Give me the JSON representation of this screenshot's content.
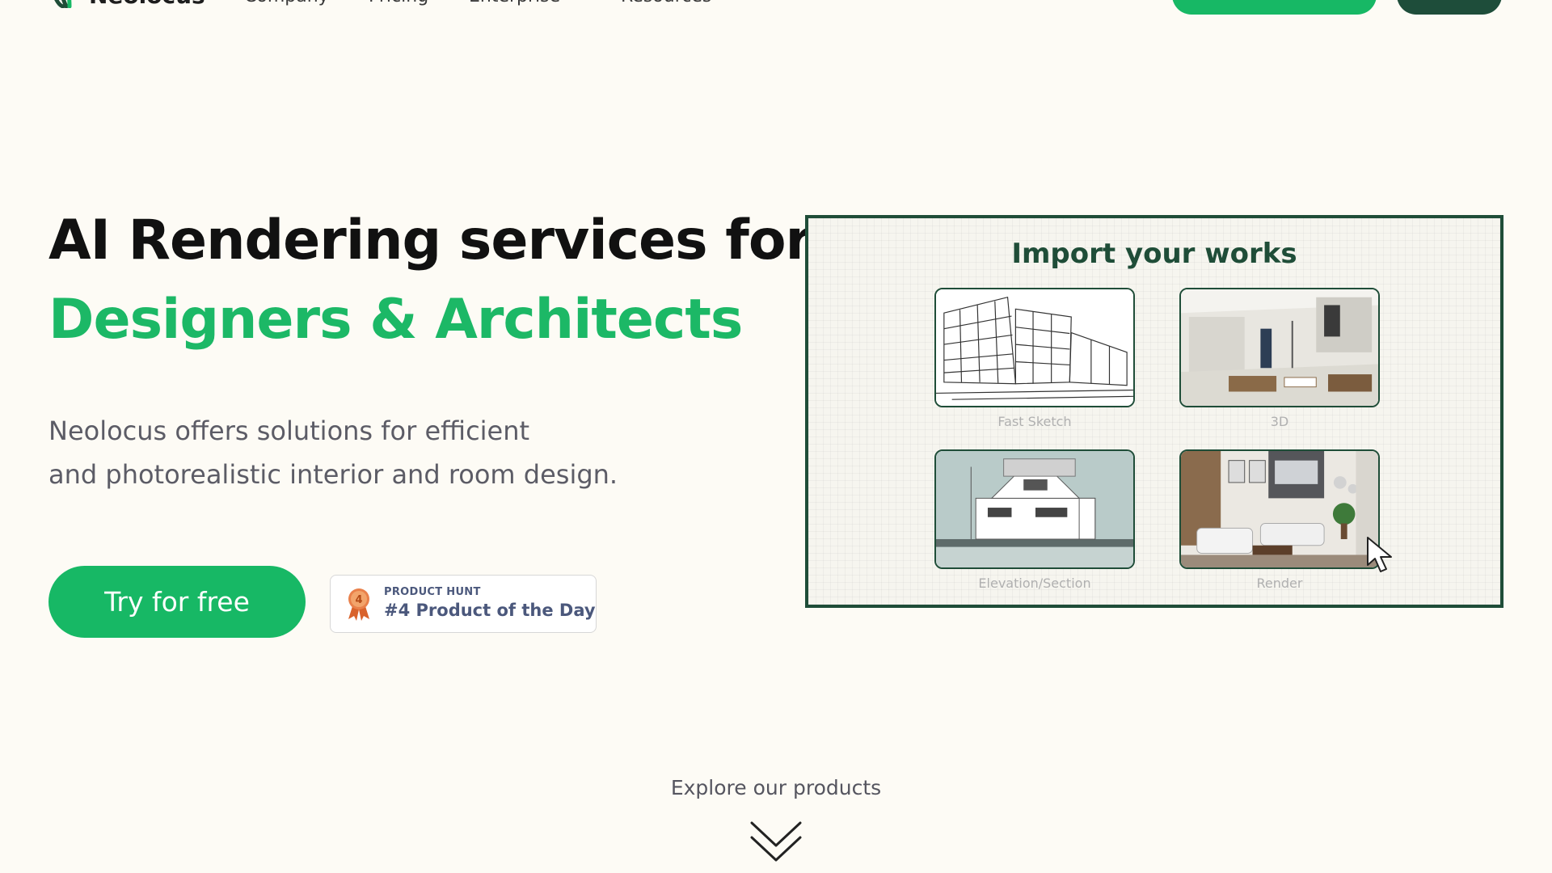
{
  "nav": {
    "logo_text": "Neolocus",
    "links": [
      "Company",
      "Pricing",
      "Enterprise",
      "Resources"
    ]
  },
  "hero": {
    "title_line1": "AI Rendering services for",
    "title_line2": "Designers & Architects",
    "description_line1": "Neolocus offers solutions for efficient",
    "description_line2": "and photorealistic interior and room design.",
    "cta_label": "Try for free",
    "badge": {
      "small": "PRODUCT HUNT",
      "big": "#4 Product of the Day",
      "medal_number": "4"
    }
  },
  "import_panel": {
    "title": "Import your works",
    "cards": [
      {
        "label": "Fast Sketch",
        "icon": "sketch-image"
      },
      {
        "label": "3D",
        "icon": "3d-interior-image"
      },
      {
        "label": "Elevation/Section",
        "icon": "elevation-image"
      },
      {
        "label": "Render",
        "icon": "render-image"
      }
    ]
  },
  "explore": {
    "label": "Explore our products"
  },
  "colors": {
    "background": "#fdfbf5",
    "brand_green": "#17b865",
    "dark_green": "#1f4d38",
    "text_dark": "#111111",
    "text_muted": "#5c5c66",
    "badge_text": "#4b587c"
  }
}
